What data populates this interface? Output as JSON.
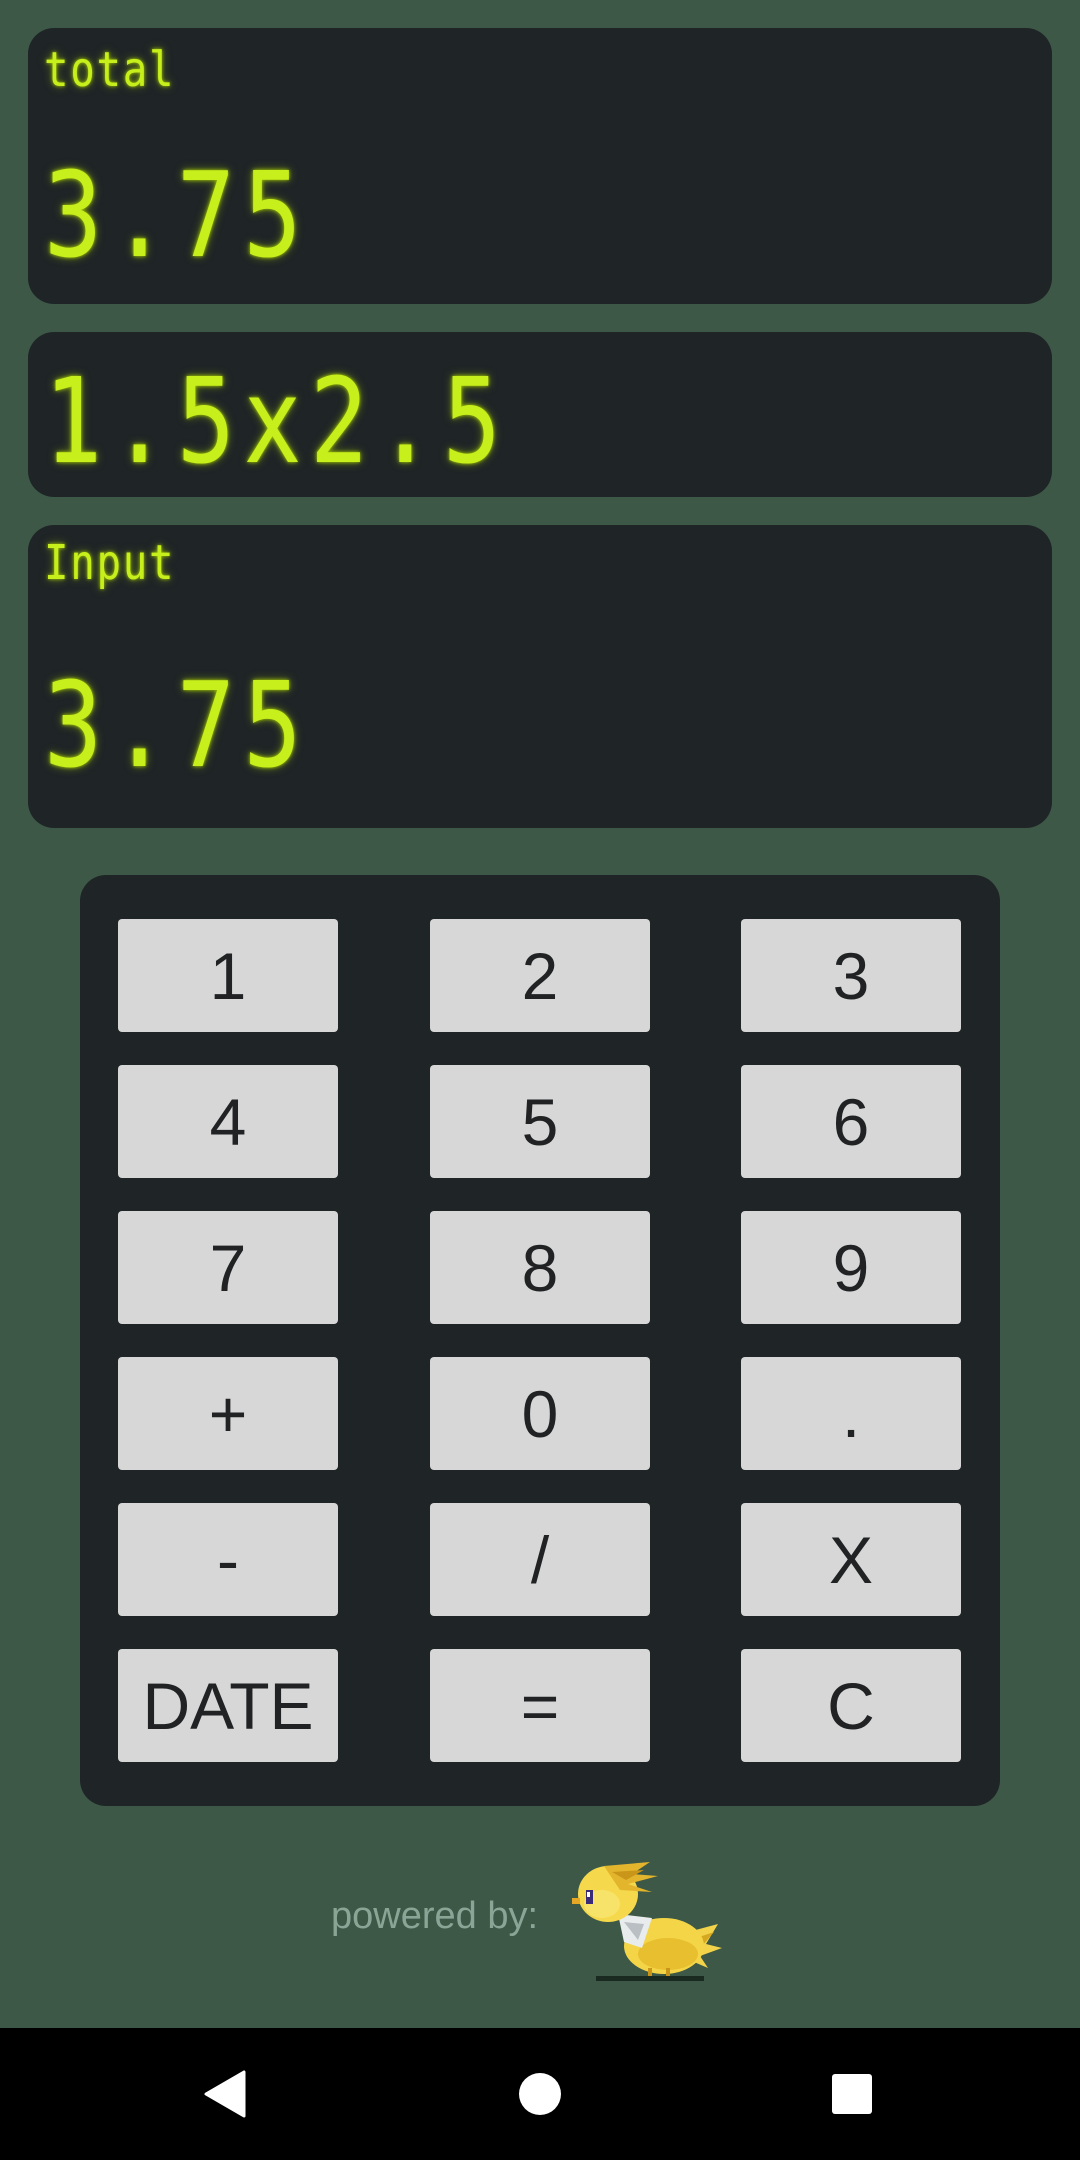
{
  "display": {
    "total_label": "total",
    "total_value": "3.75",
    "expression": "1.5x2.5",
    "input_label": "Input",
    "input_value": "3.75"
  },
  "keypad": {
    "k1": "1",
    "k2": "2",
    "k3": "3",
    "k4": "4",
    "k5": "5",
    "k6": "6",
    "k7": "7",
    "k8": "8",
    "k9": "9",
    "plus": "+",
    "k0": "0",
    "dot": ".",
    "minus": "-",
    "divide": "/",
    "multiply": "X",
    "date": "DATE",
    "equals": "=",
    "clear": "C"
  },
  "footer": {
    "powered_by": "powered by:",
    "mascot_icon": "yellow-bird-mascot-icon"
  },
  "navbar": {
    "back_icon": "back-triangle-icon",
    "home_icon": "home-circle-icon",
    "recent_icon": "recent-apps-square-icon"
  },
  "colors": {
    "background": "#3d5847",
    "panel": "#1f2426",
    "lcd_text": "#c6ef1c",
    "key": "#d6d7d6",
    "key_text": "#202224",
    "powered_text": "#8aa596",
    "navbar": "#000000"
  }
}
